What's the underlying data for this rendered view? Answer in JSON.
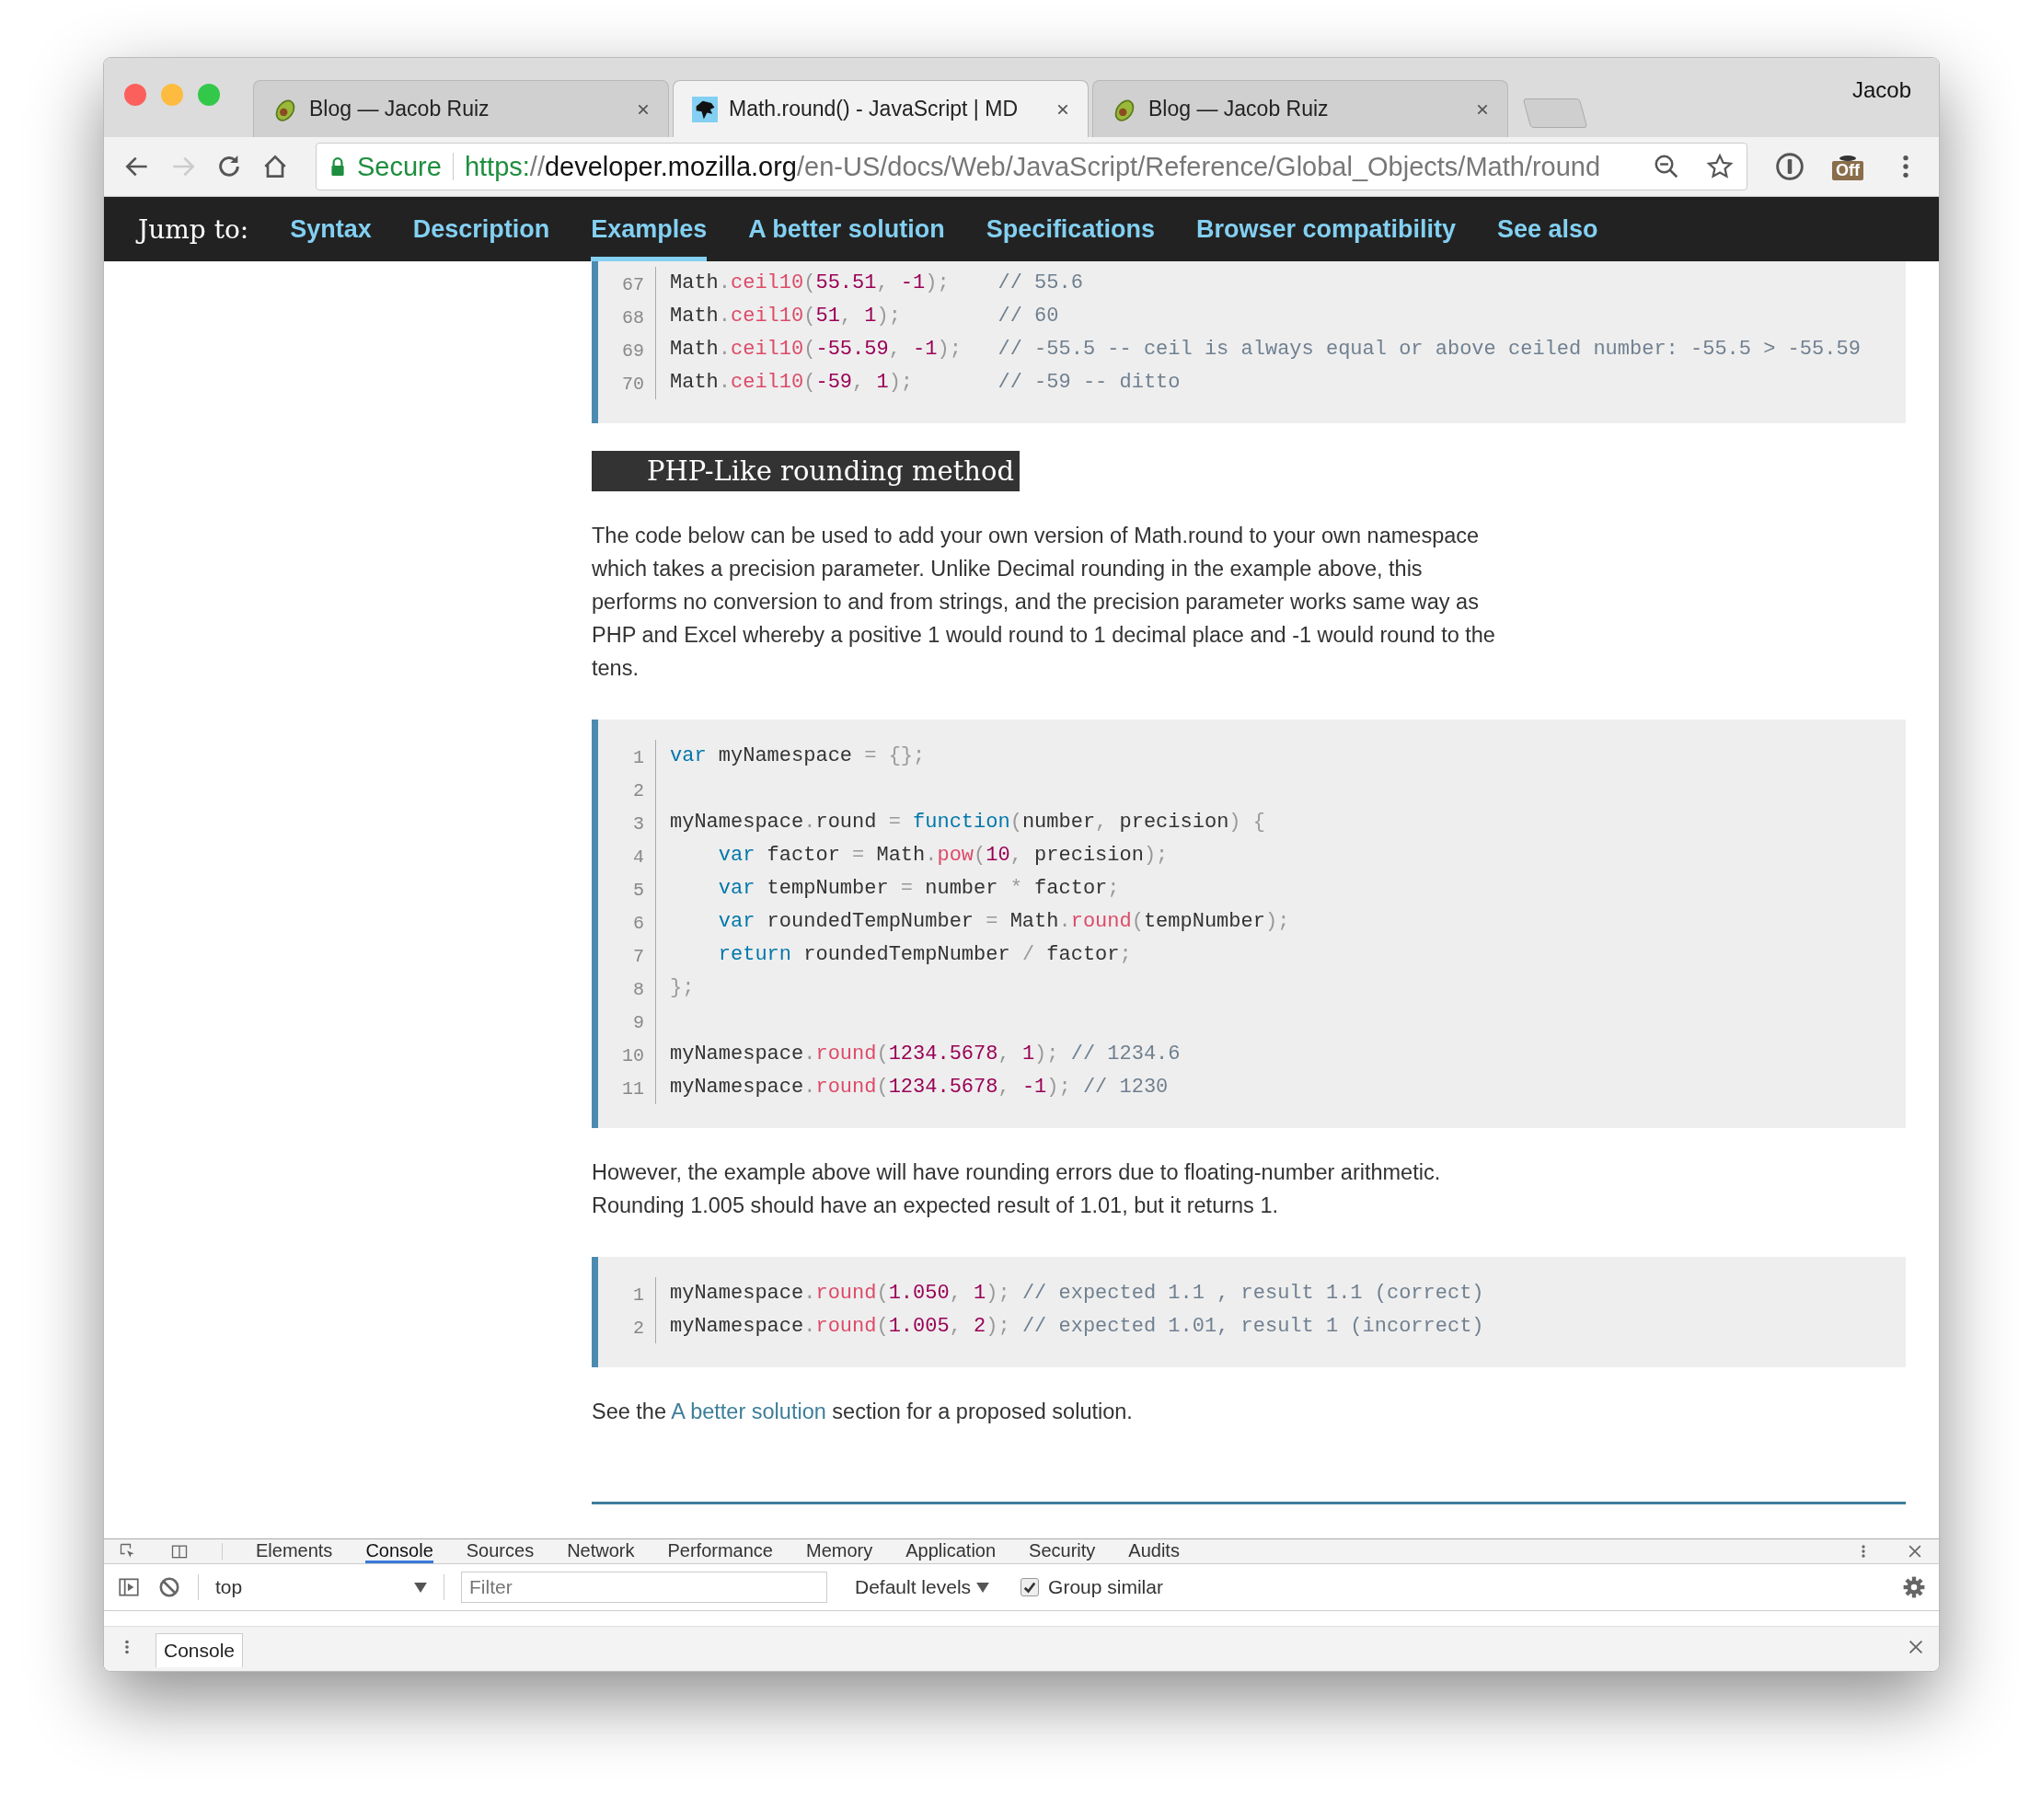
{
  "browser": {
    "tabs": [
      {
        "title": "Blog — Jacob Ruiz",
        "kind": "avocado",
        "selected": false
      },
      {
        "title": "Math.round() - JavaScript | MD",
        "kind": "mdn",
        "selected": true
      },
      {
        "title": "Blog — Jacob Ruiz",
        "kind": "avocado",
        "selected": false
      }
    ],
    "profile": "Jacob",
    "security": "Secure",
    "url": [
      {
        "kind": "scheme",
        "text": "https:"
      },
      {
        "kind": "path",
        "text": "//"
      },
      {
        "kind": "host",
        "text": "developer.mozilla.org"
      },
      {
        "kind": "path",
        "text": "/en-US/docs/Web/JavaScript/Reference/Global_Objects/Math/round"
      }
    ],
    "extension_badge": "Off"
  },
  "jump_bar": {
    "label": "Jump to:",
    "links": [
      {
        "text": "Syntax",
        "selected": false
      },
      {
        "text": "Description",
        "selected": false
      },
      {
        "text": "Examples",
        "selected": true
      },
      {
        "text": "A better solution",
        "selected": false
      },
      {
        "text": "Specifications",
        "selected": false
      },
      {
        "text": "Browser compatibility",
        "selected": false
      },
      {
        "text": "See also",
        "selected": false
      }
    ]
  },
  "content": [
    {
      "kind": "code",
      "cut_top": true,
      "lines": [
        {
          "number": "67",
          "tokens": [
            {
              "kind": "plain",
              "text": "Math"
            },
            {
              "kind": "punct",
              "text": "."
            },
            {
              "kind": "func",
              "text": "ceil10"
            },
            {
              "kind": "punct",
              "text": "("
            },
            {
              "kind": "num",
              "text": "55.51"
            },
            {
              "kind": "punct",
              "text": ", "
            },
            {
              "kind": "num",
              "text": "-1"
            },
            {
              "kind": "punct",
              "text": ");"
            },
            {
              "kind": "comment",
              "text": "    // 55.6"
            }
          ]
        },
        {
          "number": "68",
          "tokens": [
            {
              "kind": "plain",
              "text": "Math"
            },
            {
              "kind": "punct",
              "text": "."
            },
            {
              "kind": "func",
              "text": "ceil10"
            },
            {
              "kind": "punct",
              "text": "("
            },
            {
              "kind": "num",
              "text": "51"
            },
            {
              "kind": "punct",
              "text": ", "
            },
            {
              "kind": "num",
              "text": "1"
            },
            {
              "kind": "punct",
              "text": ");"
            },
            {
              "kind": "comment",
              "text": "        // 60"
            }
          ]
        },
        {
          "number": "69",
          "tokens": [
            {
              "kind": "plain",
              "text": "Math"
            },
            {
              "kind": "punct",
              "text": "."
            },
            {
              "kind": "func",
              "text": "ceil10"
            },
            {
              "kind": "punct",
              "text": "("
            },
            {
              "kind": "num",
              "text": "-55.59"
            },
            {
              "kind": "punct",
              "text": ", "
            },
            {
              "kind": "num",
              "text": "-1"
            },
            {
              "kind": "punct",
              "text": ");"
            },
            {
              "kind": "comment",
              "text": "   // -55.5 -- ceil is always equal or above ceiled number: -55.5 > -55.59"
            }
          ]
        },
        {
          "number": "70",
          "tokens": [
            {
              "kind": "plain",
              "text": "Math"
            },
            {
              "kind": "punct",
              "text": "."
            },
            {
              "kind": "func",
              "text": "ceil10"
            },
            {
              "kind": "punct",
              "text": "("
            },
            {
              "kind": "num",
              "text": "-59"
            },
            {
              "kind": "punct",
              "text": ", "
            },
            {
              "kind": "num",
              "text": "1"
            },
            {
              "kind": "punct",
              "text": ");"
            },
            {
              "kind": "comment",
              "text": "       // -59 -- ditto"
            }
          ]
        }
      ]
    },
    {
      "kind": "heading",
      "text": "PHP-Like rounding method"
    },
    {
      "kind": "paragraph",
      "text": "The code below can be used to add your own version of Math.round to your own namespace which takes a precision parameter. Unlike Decimal rounding in the example above, this performs no conversion to and from strings, and the precision parameter works same way as PHP and Excel whereby a positive 1 would round to 1 decimal place and -1 would round to the tens."
    },
    {
      "kind": "code",
      "cut_top": false,
      "lines": [
        {
          "number": "1",
          "tokens": [
            {
              "kind": "keyword",
              "text": "var"
            },
            {
              "kind": "plain",
              "text": " myNamespace "
            },
            {
              "kind": "punct",
              "text": "= {};"
            }
          ]
        },
        {
          "number": "2"
        },
        {
          "number": "3",
          "tokens": [
            {
              "kind": "plain",
              "text": "myNamespace"
            },
            {
              "kind": "punct",
              "text": "."
            },
            {
              "kind": "plain",
              "text": "round "
            },
            {
              "kind": "punct",
              "text": "= "
            },
            {
              "kind": "keyword",
              "text": "function"
            },
            {
              "kind": "punct",
              "text": "("
            },
            {
              "kind": "plain",
              "text": "number"
            },
            {
              "kind": "punct",
              "text": ", "
            },
            {
              "kind": "plain",
              "text": "precision"
            },
            {
              "kind": "punct",
              "text": ") {"
            }
          ]
        },
        {
          "number": "4",
          "tokens": [
            {
              "kind": "keyword",
              "text": "    var"
            },
            {
              "kind": "plain",
              "text": " factor "
            },
            {
              "kind": "punct",
              "text": "= "
            },
            {
              "kind": "plain",
              "text": "Math"
            },
            {
              "kind": "punct",
              "text": "."
            },
            {
              "kind": "func",
              "text": "pow"
            },
            {
              "kind": "punct",
              "text": "("
            },
            {
              "kind": "num",
              "text": "10"
            },
            {
              "kind": "punct",
              "text": ", "
            },
            {
              "kind": "plain",
              "text": "precision"
            },
            {
              "kind": "punct",
              "text": ");"
            }
          ]
        },
        {
          "number": "5",
          "tokens": [
            {
              "kind": "keyword",
              "text": "    var"
            },
            {
              "kind": "plain",
              "text": " tempNumber "
            },
            {
              "kind": "punct",
              "text": "= "
            },
            {
              "kind": "plain",
              "text": "number "
            },
            {
              "kind": "punct",
              "text": "* "
            },
            {
              "kind": "plain",
              "text": "factor"
            },
            {
              "kind": "punct",
              "text": ";"
            }
          ]
        },
        {
          "number": "6",
          "tokens": [
            {
              "kind": "keyword",
              "text": "    var"
            },
            {
              "kind": "plain",
              "text": " roundedTempNumber "
            },
            {
              "kind": "punct",
              "text": "= "
            },
            {
              "kind": "plain",
              "text": "Math"
            },
            {
              "kind": "punct",
              "text": "."
            },
            {
              "kind": "func",
              "text": "round"
            },
            {
              "kind": "punct",
              "text": "("
            },
            {
              "kind": "plain",
              "text": "tempNumber"
            },
            {
              "kind": "punct",
              "text": ");"
            }
          ]
        },
        {
          "number": "7",
          "tokens": [
            {
              "kind": "keyword",
              "text": "    return"
            },
            {
              "kind": "plain",
              "text": " roundedTempNumber "
            },
            {
              "kind": "punct",
              "text": "/ "
            },
            {
              "kind": "plain",
              "text": "factor"
            },
            {
              "kind": "punct",
              "text": ";"
            }
          ]
        },
        {
          "number": "8",
          "tokens": [
            {
              "kind": "punct",
              "text": "};"
            }
          ]
        },
        {
          "number": "9"
        },
        {
          "number": "10",
          "tokens": [
            {
              "kind": "plain",
              "text": "myNamespace"
            },
            {
              "kind": "punct",
              "text": "."
            },
            {
              "kind": "func",
              "text": "round"
            },
            {
              "kind": "punct",
              "text": "("
            },
            {
              "kind": "num",
              "text": "1234.5678"
            },
            {
              "kind": "punct",
              "text": ", "
            },
            {
              "kind": "num",
              "text": "1"
            },
            {
              "kind": "punct",
              "text": "); "
            },
            {
              "kind": "comment",
              "text": "// 1234.6"
            }
          ]
        },
        {
          "number": "11",
          "tokens": [
            {
              "kind": "plain",
              "text": "myNamespace"
            },
            {
              "kind": "punct",
              "text": "."
            },
            {
              "kind": "func",
              "text": "round"
            },
            {
              "kind": "punct",
              "text": "("
            },
            {
              "kind": "num",
              "text": "1234.5678"
            },
            {
              "kind": "punct",
              "text": ", "
            },
            {
              "kind": "num",
              "text": "-1"
            },
            {
              "kind": "punct",
              "text": "); "
            },
            {
              "kind": "comment",
              "text": "// 1230"
            }
          ]
        }
      ]
    },
    {
      "kind": "paragraph",
      "text": "However, the example above will have rounding errors due to floating-number arithmetic. Rounding 1.005 should have an expected result of 1.01, but it returns 1."
    },
    {
      "kind": "code",
      "cut_top": false,
      "lines": [
        {
          "number": "1",
          "tokens": [
            {
              "kind": "plain",
              "text": "myNamespace"
            },
            {
              "kind": "punct",
              "text": "."
            },
            {
              "kind": "func",
              "text": "round"
            },
            {
              "kind": "punct",
              "text": "("
            },
            {
              "kind": "num",
              "text": "1.050"
            },
            {
              "kind": "punct",
              "text": ", "
            },
            {
              "kind": "num",
              "text": "1"
            },
            {
              "kind": "punct",
              "text": "); "
            },
            {
              "kind": "comment",
              "text": "// expected 1.1 , result 1.1 (correct)"
            }
          ]
        },
        {
          "number": "2",
          "tokens": [
            {
              "kind": "plain",
              "text": "myNamespace"
            },
            {
              "kind": "punct",
              "text": "."
            },
            {
              "kind": "func",
              "text": "round"
            },
            {
              "kind": "punct",
              "text": "("
            },
            {
              "kind": "num",
              "text": "1.005"
            },
            {
              "kind": "punct",
              "text": ", "
            },
            {
              "kind": "num",
              "text": "2"
            },
            {
              "kind": "punct",
              "text": "); "
            },
            {
              "kind": "comment",
              "text": "// expected 1.01, result 1 (incorrect)"
            }
          ]
        }
      ]
    },
    {
      "kind": "link_paragraph",
      "before": "See the ",
      "link": "A better solution",
      "after": " section for a proposed solution."
    },
    {
      "kind": "rule"
    }
  ],
  "devtools": {
    "tabs": [
      {
        "label": "Elements",
        "selected": false
      },
      {
        "label": "Console",
        "selected": true
      },
      {
        "label": "Sources",
        "selected": false
      },
      {
        "label": "Network",
        "selected": false
      },
      {
        "label": "Performance",
        "selected": false
      },
      {
        "label": "Memory",
        "selected": false
      },
      {
        "label": "Application",
        "selected": false
      },
      {
        "label": "Security",
        "selected": false
      },
      {
        "label": "Audits",
        "selected": false
      }
    ],
    "context": "top",
    "filter_placeholder": "Filter",
    "levels": "Default levels",
    "group_similar": {
      "label": "Group similar",
      "checked": true
    },
    "drawer_tab": "Console"
  }
}
